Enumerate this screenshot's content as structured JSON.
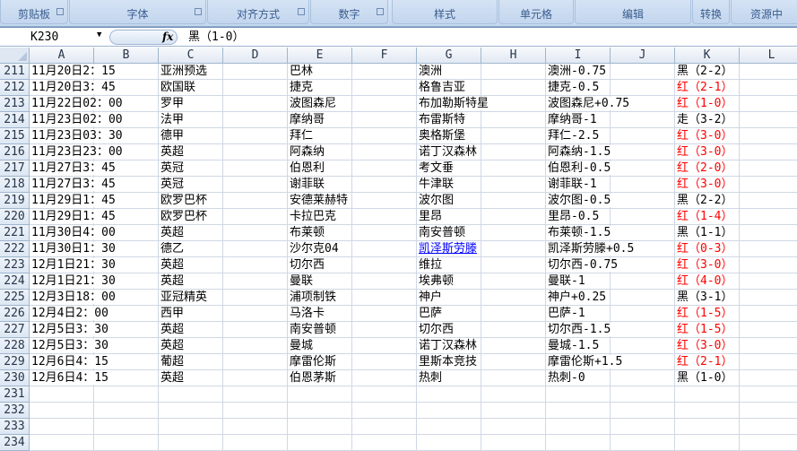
{
  "ribbon": {
    "groups": [
      "剪贴板",
      "字体",
      "对齐方式",
      "数字",
      "样式",
      "单元格",
      "编辑",
      "转换",
      "资源中"
    ]
  },
  "formula_bar": {
    "name_box": "K230",
    "fx": "fx",
    "value": "黑（1-0）"
  },
  "columns": [
    "A",
    "B",
    "C",
    "D",
    "E",
    "F",
    "G",
    "H",
    "I",
    "J",
    "K",
    "L"
  ],
  "rows": [
    {
      "n": "211",
      "A": "11月20日2：15",
      "C": "亚洲预选",
      "E": "巴林",
      "G": "澳洲",
      "I": "澳洲-0.75",
      "K": "黑（2-2）",
      "K_color": "black"
    },
    {
      "n": "212",
      "A": "11月20日3：45",
      "C": "欧国联",
      "E": "捷克",
      "G": "格鲁吉亚",
      "I": "捷克-0.5",
      "K": "红（2-1）",
      "K_color": "red"
    },
    {
      "n": "213",
      "A": "11月22日02：00",
      "C": "罗甲",
      "E": "波图森尼",
      "G": "布加勒斯特星",
      "I": "波图森尼+0.75",
      "K": "红（1-0）",
      "K_color": "red"
    },
    {
      "n": "214",
      "A": "11月23日02：00",
      "C": "法甲",
      "E": "摩纳哥",
      "G": "布雷斯特",
      "I": "摩纳哥-1",
      "K": "走（3-2）",
      "K_color": "black"
    },
    {
      "n": "215",
      "A": "11月23日03：30",
      "C": "德甲",
      "E": "拜仁",
      "G": "奥格斯堡",
      "I": "拜仁-2.5",
      "K": "红（3-0）",
      "K_color": "red"
    },
    {
      "n": "216",
      "A": "11月23日23：00",
      "C": "英超",
      "E": "阿森纳",
      "G": "诺丁汉森林",
      "I": "阿森纳-1.5",
      "K": "红（3-0）",
      "K_color": "red"
    },
    {
      "n": "217",
      "A": "11月27日3：45",
      "C": "英冠",
      "E": "伯恩利",
      "G": "考文垂",
      "I": "伯恩利-0.5",
      "K": "红（2-0）",
      "K_color": "red"
    },
    {
      "n": "218",
      "A": "11月27日3：45",
      "C": "英冠",
      "E": "谢菲联",
      "G": "牛津联",
      "I": "谢菲联-1",
      "K": "红（3-0）",
      "K_color": "red"
    },
    {
      "n": "219",
      "A": "11月29日1：45",
      "C": "欧罗巴杯",
      "E": "安德莱赫特",
      "G": "波尔图",
      "I": "波尔图-0.5",
      "K": "黑（2-2）",
      "K_color": "black"
    },
    {
      "n": "220",
      "A": "11月29日1：45",
      "C": "欧罗巴杯",
      "E": "卡拉巴克",
      "G": "里昂",
      "I": "里昂-0.5",
      "K": "红（1-4）",
      "K_color": "red"
    },
    {
      "n": "221",
      "A": "11月30日4：00",
      "C": "英超",
      "E": "布莱顿",
      "G": "南安普顿",
      "I": "布莱顿-1.5",
      "K": "黑（1-1）",
      "K_color": "black"
    },
    {
      "n": "222",
      "A": "11月30日1：30",
      "C": "德乙",
      "E": "沙尔克04",
      "G": "凯泽斯劳滕",
      "G_link": true,
      "I": "凯泽斯劳滕+0.5",
      "K": "红（0-3）",
      "K_color": "red"
    },
    {
      "n": "223",
      "A": "12月1日21：30",
      "C": "英超",
      "E": "切尔西",
      "G": "维拉",
      "I": "切尔西-0.75",
      "K": "红（3-0）",
      "K_color": "red"
    },
    {
      "n": "224",
      "A": "12月1日21：30",
      "C": "英超",
      "E": "曼联",
      "G": "埃弗顿",
      "I": "曼联-1",
      "K": "红（4-0）",
      "K_color": "red"
    },
    {
      "n": "225",
      "A": "12月3日18：00",
      "C": "亚冠精英",
      "E": "浦项制铁",
      "G": "神户",
      "I": "神户+0.25",
      "K": "黑（3-1）",
      "K_color": "black"
    },
    {
      "n": "226",
      "A": "12月4日2：00",
      "C": "西甲",
      "E": "马洛卡",
      "G": "巴萨",
      "I": "巴萨-1",
      "K": "红（1-5）",
      "K_color": "red"
    },
    {
      "n": "227",
      "A": "12月5日3：30",
      "C": "英超",
      "E": "南安普顿",
      "G": "切尔西",
      "I": "切尔西-1.5",
      "K": "红（1-5）",
      "K_color": "red"
    },
    {
      "n": "228",
      "A": "12月5日3：30",
      "C": "英超",
      "E": "曼城",
      "G": "诺丁汉森林",
      "I": "曼城-1.5",
      "K": "红（3-0）",
      "K_color": "red"
    },
    {
      "n": "229",
      "A": "12月6日4：15",
      "C": "葡超",
      "E": "摩雷伦斯",
      "G": "里斯本竞技",
      "I": "摩雷伦斯+1.5",
      "K": "红（2-1）",
      "K_color": "red"
    },
    {
      "n": "230",
      "A": "12月6日4：15",
      "C": "英超",
      "E": "伯恩茅斯",
      "G": "热刺",
      "I": "热刺-0",
      "K": "黑（1-0）",
      "K_color": "black"
    },
    {
      "n": "231"
    },
    {
      "n": "232"
    },
    {
      "n": "233"
    },
    {
      "n": "234"
    }
  ],
  "colors": {
    "red": "#ff0000",
    "link": "#0000ff"
  }
}
